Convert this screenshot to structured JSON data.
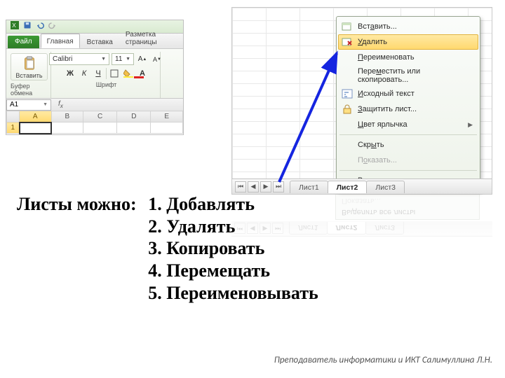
{
  "ribbon_left": {
    "file_tab": "Файл",
    "tabs": [
      "Главная",
      "Вставка",
      "Разметка страницы"
    ],
    "active_tab": "Главная",
    "clipboard_group": "Буфер обмена",
    "paste_label": "Вставить",
    "font_group": "Шрифт",
    "font_name": "Calibri",
    "font_size": "11",
    "bold": "Ж",
    "italic": "К",
    "underline": "Ч",
    "name_box": "A1",
    "columns": [
      "A",
      "B",
      "C",
      "D",
      "E"
    ],
    "rows": [
      "1"
    ]
  },
  "sheets": {
    "list": [
      "Лист1",
      "Лист2",
      "Лист3"
    ],
    "active": "Лист2"
  },
  "context_menu": {
    "items": [
      {
        "label": "Вставить...",
        "icon": "insert",
        "underline": "а"
      },
      {
        "label": "Удалить",
        "icon": "delete",
        "highlight": true,
        "underline": "У"
      },
      {
        "label": "Переименовать",
        "underline": "П"
      },
      {
        "label": "Переместить или скопировать...",
        "underline": "м"
      },
      {
        "label": "Исходный текст",
        "icon": "code",
        "underline": "И"
      },
      {
        "label": "Защитить лист...",
        "icon": "protect",
        "underline": "З"
      },
      {
        "label": "Цвет ярлычка",
        "submenu": true,
        "underline": "Ц"
      },
      {
        "label": "Скрыть",
        "underline": "ы"
      },
      {
        "label": "Показать...",
        "disabled": true,
        "underline": "о"
      },
      {
        "label": "Выделить все листы",
        "underline": "В"
      }
    ]
  },
  "lesson": {
    "heading": "Листы можно:",
    "points": [
      "1. Добавлять",
      "2. Удалять",
      "3. Копировать",
      "4. Перемещать",
      "5. Переименовывать"
    ]
  },
  "footer": "Преподаватель информатики и ИКТ Салимуллина Л.Н.",
  "colors": {
    "accent_green": "#2e7d27",
    "arrow": "#1525e0",
    "highlight": "#ffd96f"
  }
}
